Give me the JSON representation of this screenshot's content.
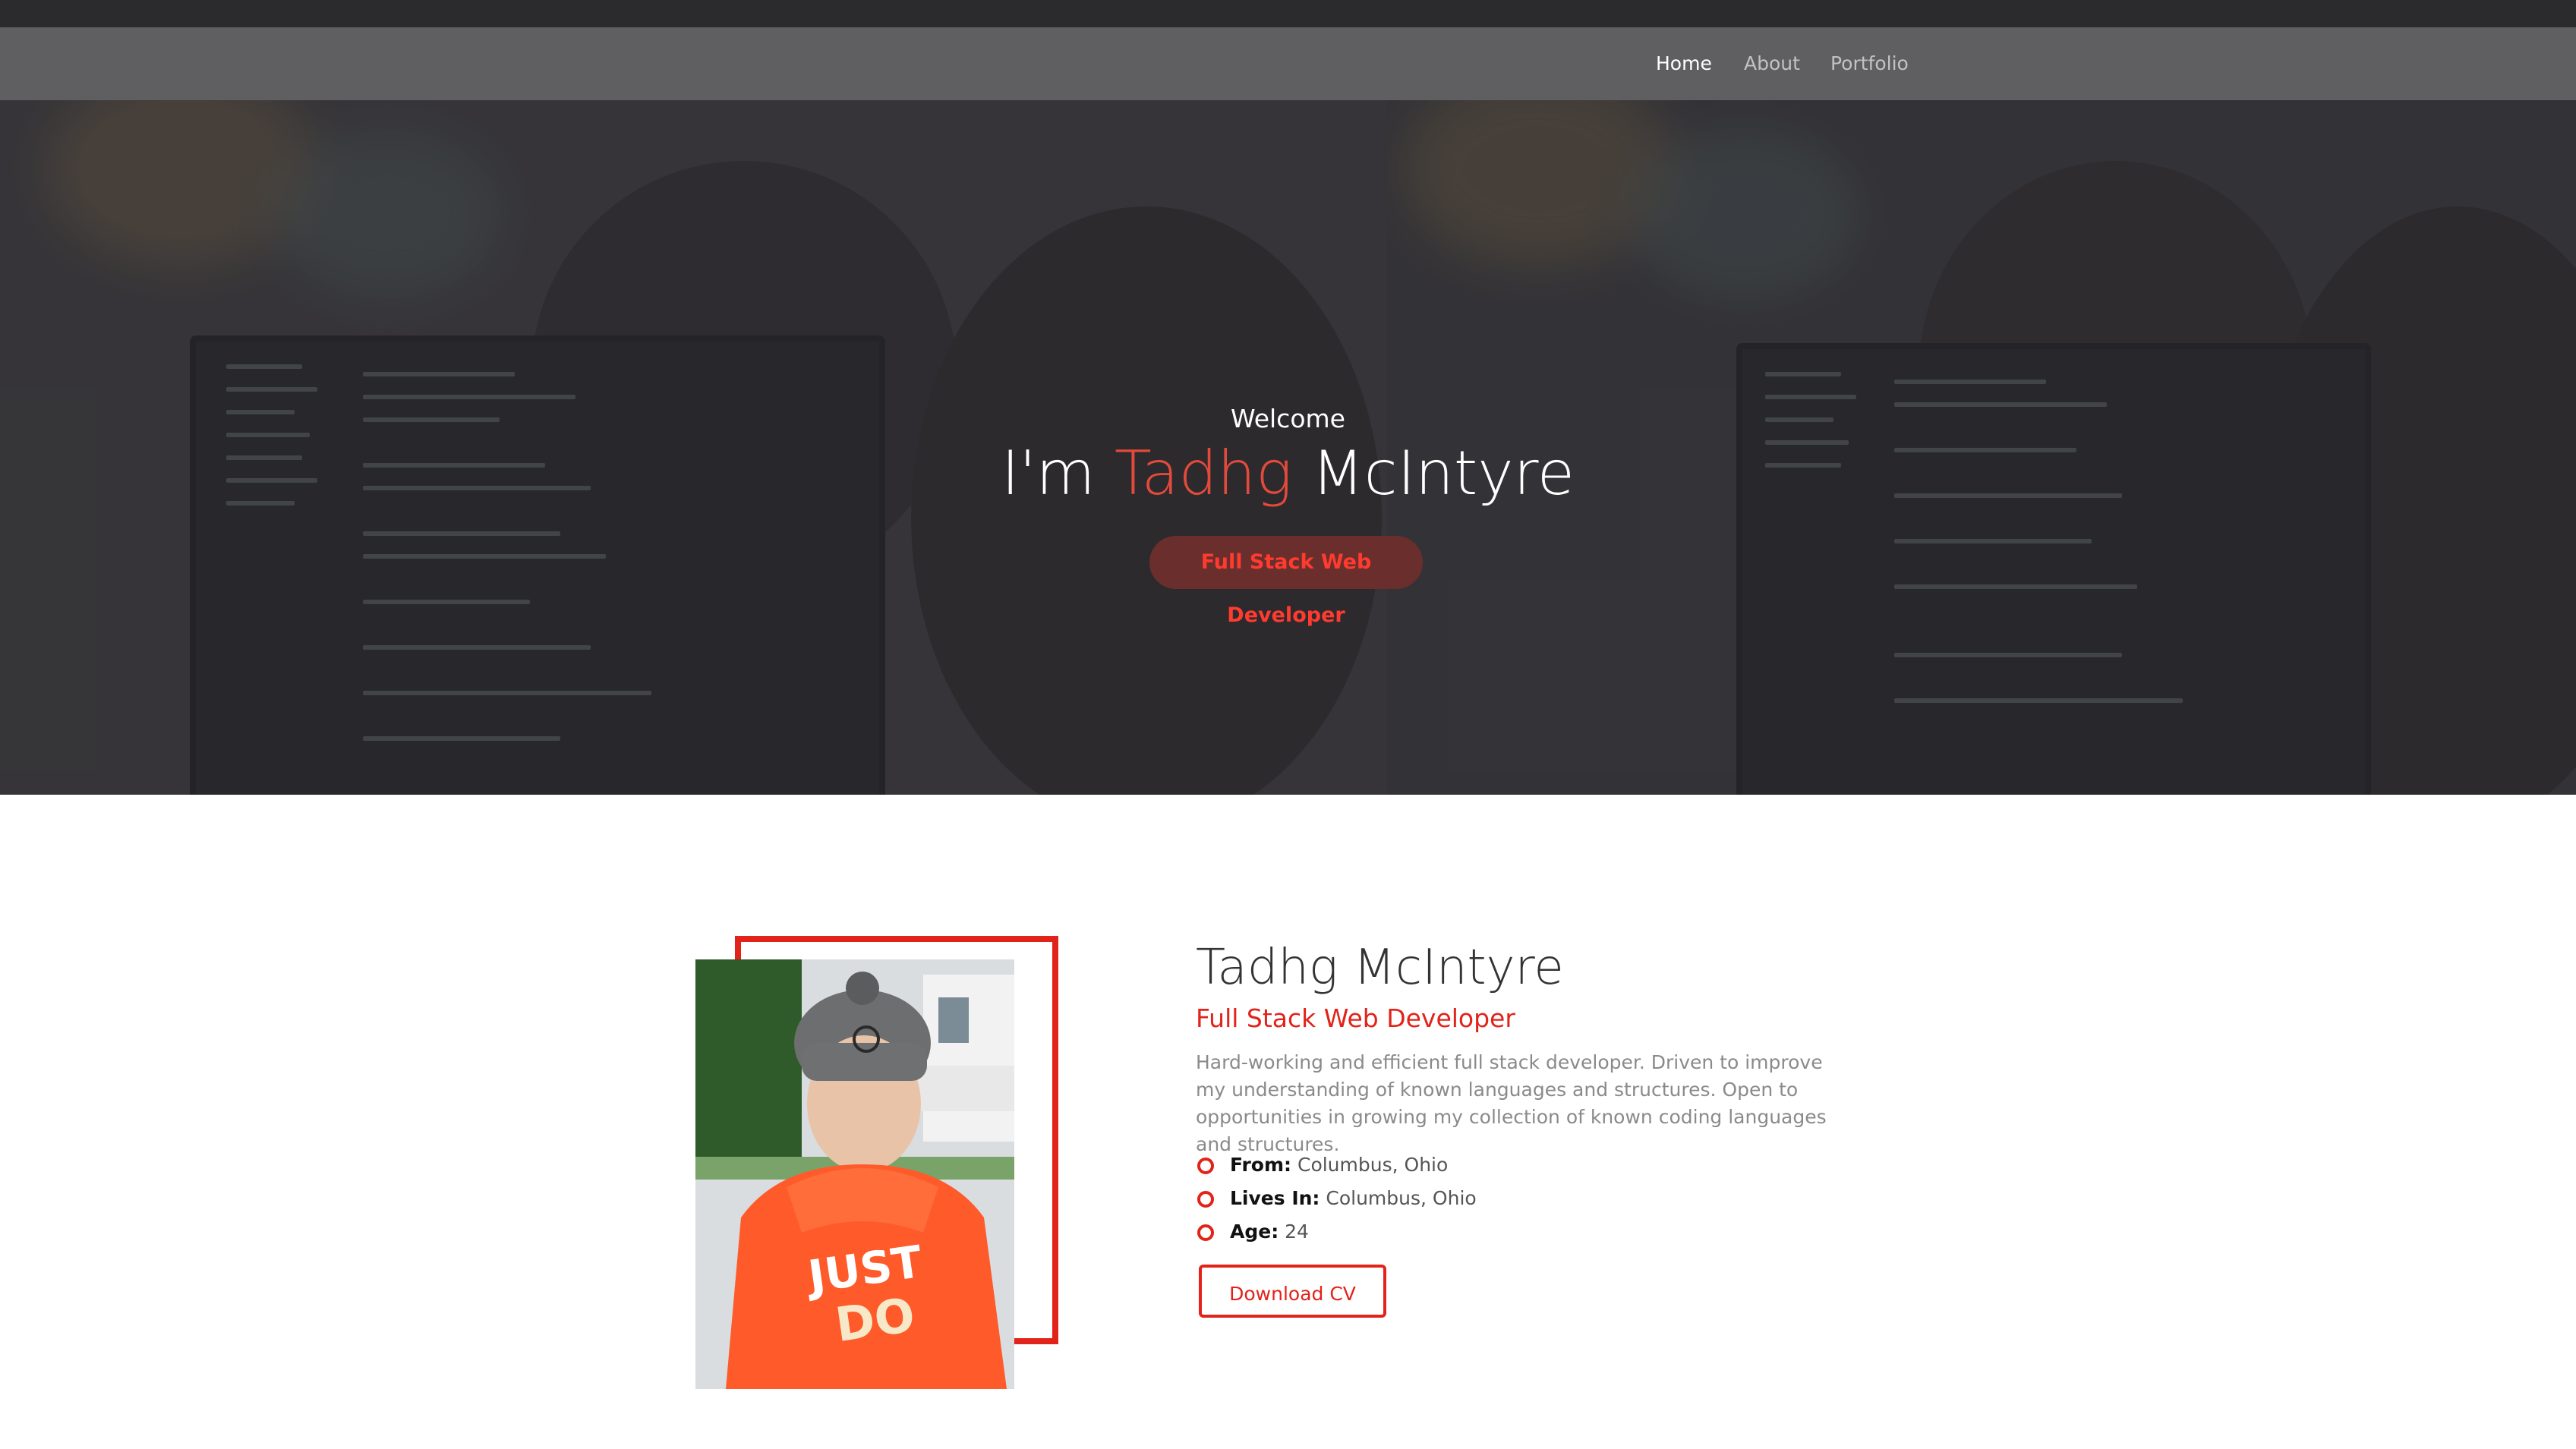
{
  "nav": {
    "items": [
      {
        "label": "Home",
        "active": true
      },
      {
        "label": "About",
        "active": false
      },
      {
        "label": "Portfolio",
        "active": false
      }
    ]
  },
  "hero": {
    "welcome": "Welcome",
    "title_prefix": "I'm",
    "first_name": "Tadhg",
    "last_name": "McIntyre",
    "role_badge": "Full Stack Web Developer"
  },
  "about": {
    "name": "Tadhg McIntyre",
    "role": "Full Stack Web Developer",
    "description": "Hard-working and efficient full stack developer. Driven to improve my understanding of known languages and structures. Open to opportunities in growing my collection of known coding languages and structures.",
    "details": [
      {
        "label": "From:",
        "value": "Columbus, Ohio"
      },
      {
        "label": "Lives In:",
        "value": "Columbus, Ohio"
      },
      {
        "label": "Age:",
        "value": "24"
      }
    ],
    "download_label": "Download CV"
  },
  "colors": {
    "accent": "#e2231a",
    "navbar": "#5f5e60",
    "hero_overlay": "#3b3a3d"
  }
}
